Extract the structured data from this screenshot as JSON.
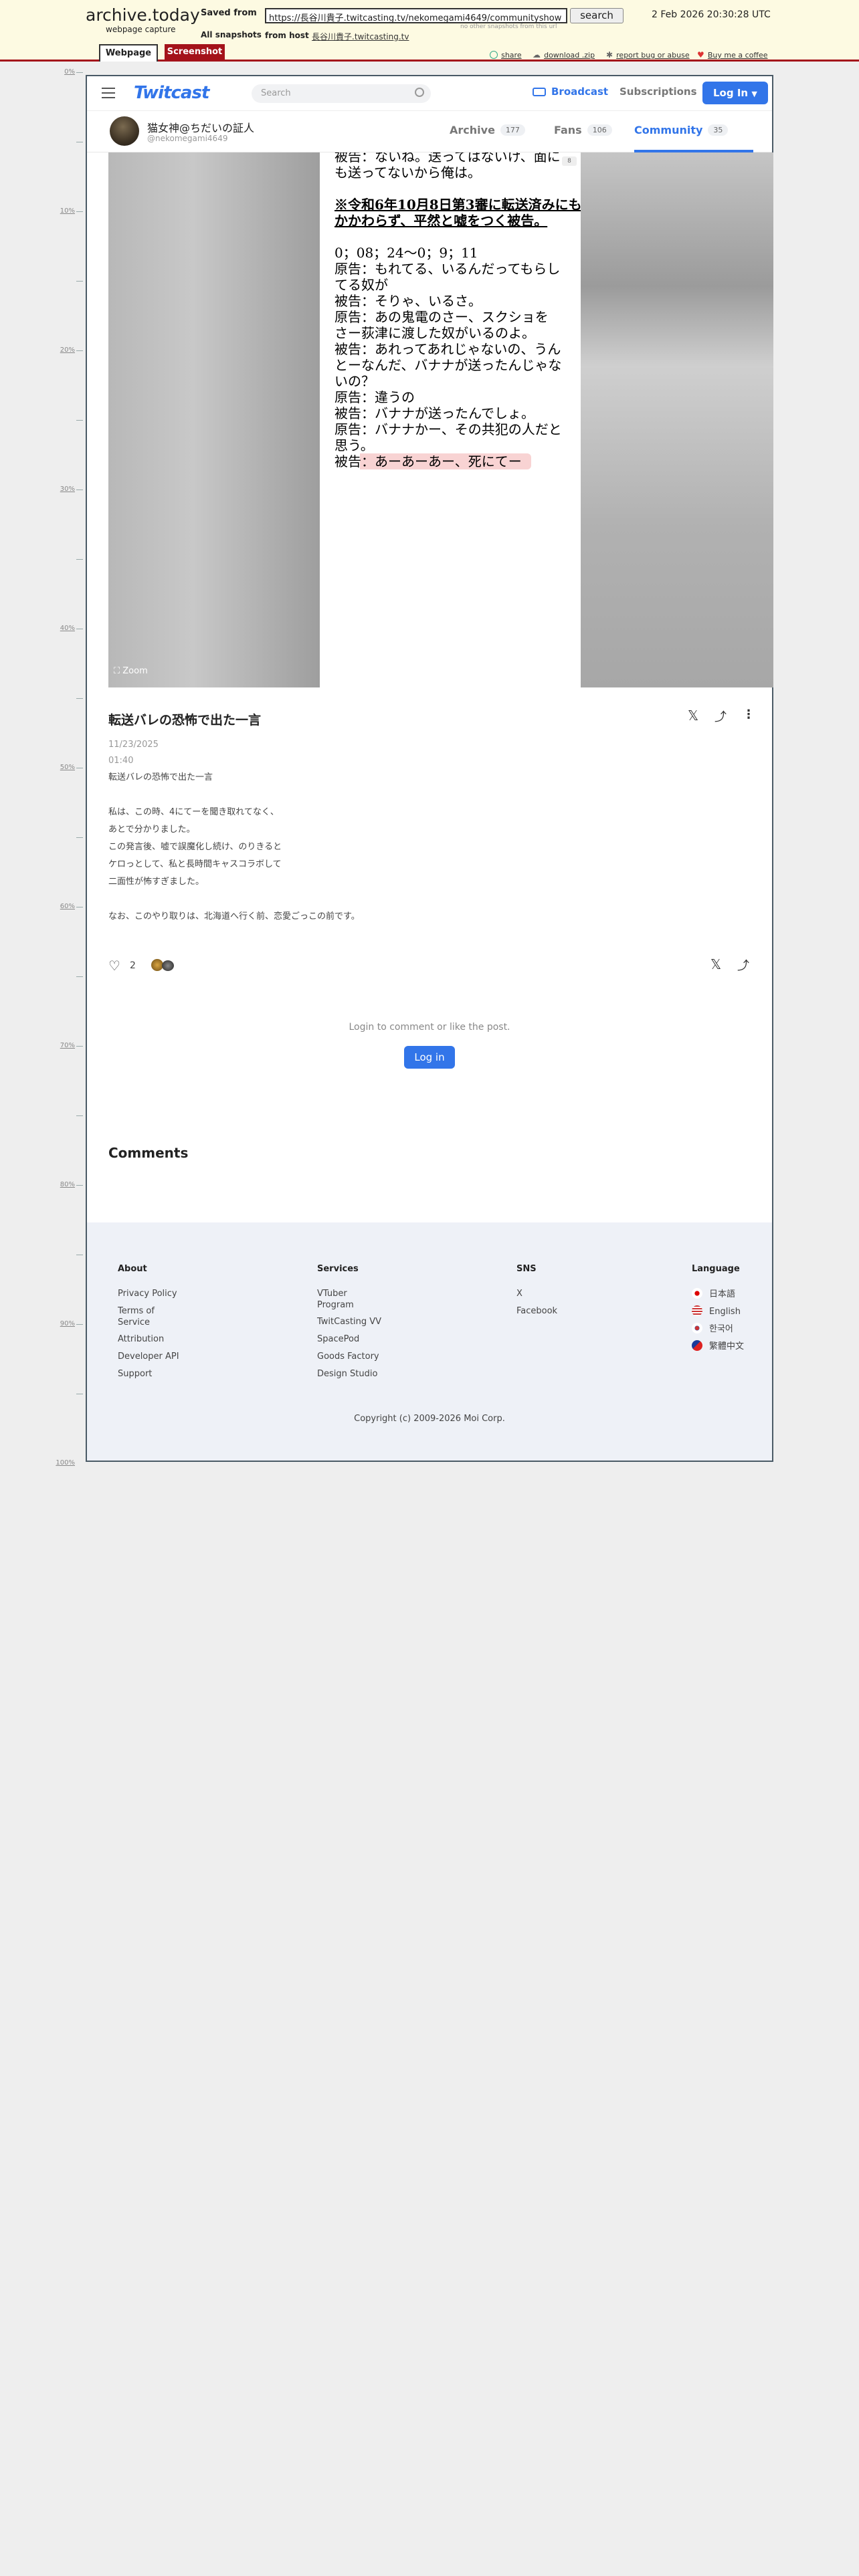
{
  "archive": {
    "logo": "archive.today",
    "logo_sub": "webpage capture",
    "saved_from_label": "Saved from",
    "url": "https://長谷川貴子.twitcasting.tv/nekomegami4649/communityshow",
    "search_label": "search",
    "no_other": "no other snapshots from this url",
    "all_snapshots_label": "All snapshots",
    "from_host_label": "from host",
    "host": "長谷川貴子.twitcasting.tv",
    "date": "2 Feb 2026 20:30:28 UTC",
    "tab_webpage": "Webpage",
    "tab_screenshot": "Screenshot",
    "share": "share",
    "download": "download .zip",
    "report": "report bug or abuse",
    "coffee": "Buy me a coffee",
    "ruler": [
      "0%",
      "10%",
      "20%",
      "30%",
      "40%",
      "50%",
      "60%",
      "70%",
      "80%",
      "90%",
      "100%"
    ]
  },
  "header": {
    "brand": "Twitcast",
    "search_placeholder": "Search",
    "broadcast": "Broadcast",
    "subscriptions": "Subscriptions",
    "login": "Log In"
  },
  "profile": {
    "name": "猫女神@ちだいの証人",
    "handle": "@nekomegami4649",
    "tabs": [
      {
        "label": "Archive",
        "count": "177"
      },
      {
        "label": "Fans",
        "count": "106"
      },
      {
        "label": "Community",
        "count": "35"
      }
    ]
  },
  "image": {
    "badge": "8",
    "zoom": "Zoom",
    "doc_lines": [
      "被告：ないね。送ってはないけ、面に",
      "も送ってないから俺は。",
      "",
      "※令和6年10月8日第3審に転送済みにも",
      "かかわらず、平然と嘘をつく被告。",
      "",
      "0；08；24〜0；9；11",
      "原告：もれてる、いるんだってもらし",
      "てる奴が",
      "被告：そりゃ、いるさ。",
      "原告：あの鬼電のさー、スクショを",
      "さー荻津に渡した奴がいるのよ。",
      "被告：あれってあれじゃないの、うん",
      "とーなんだ、バナナが送ったんじゃな",
      "いの？",
      "原告：違うの",
      "被告：バナナが送ったんでしょ。",
      "原告：バナナかー、その共犯の人だと",
      "思う。",
      "被告：あーあーあー、死にてー"
    ]
  },
  "post": {
    "title": "転送バレの恐怖で出た一言",
    "date": "11/23/2025",
    "time": "01:40",
    "body": [
      "転送バレの恐怖で出た一言",
      "",
      "私は、この時、4にてーを聞き取れてなく、",
      "あとで分かりました。",
      "この発言後、嘘で誤魔化し続け、のりきると",
      "ケロっとして、私と長時間キャスコラボして",
      "二面性が怖すぎました。",
      "",
      "なお、このやり取りは、北海道へ行く前、恋愛ごっこの前です。"
    ],
    "likes": "2",
    "login_prompt": "Login to comment or like the post.",
    "login_button": "Log in",
    "comments_heading": "Comments"
  },
  "footer": {
    "about": {
      "heading": "About",
      "links": [
        "Privacy Policy",
        "Terms of Service",
        "Attribution",
        "Developer API",
        "Support"
      ]
    },
    "services": {
      "heading": "Services",
      "links": [
        "VTuber Program",
        "TwitCasting VV",
        "SpacePod",
        "Goods Factory",
        "Design Studio"
      ]
    },
    "sns": {
      "heading": "SNS",
      "links": [
        "X",
        "Facebook"
      ]
    },
    "language": {
      "heading": "Language",
      "links": [
        "日本語",
        "English",
        "한국어",
        "繁體中文"
      ]
    },
    "copyright": "Copyright (c) 2009-2026 Moi Corp."
  },
  "colors": {
    "accent": "#3275e9",
    "archive_red": "#a4121a",
    "footer_bg": "#eef1f7",
    "highlight": "#f8d3d3"
  }
}
